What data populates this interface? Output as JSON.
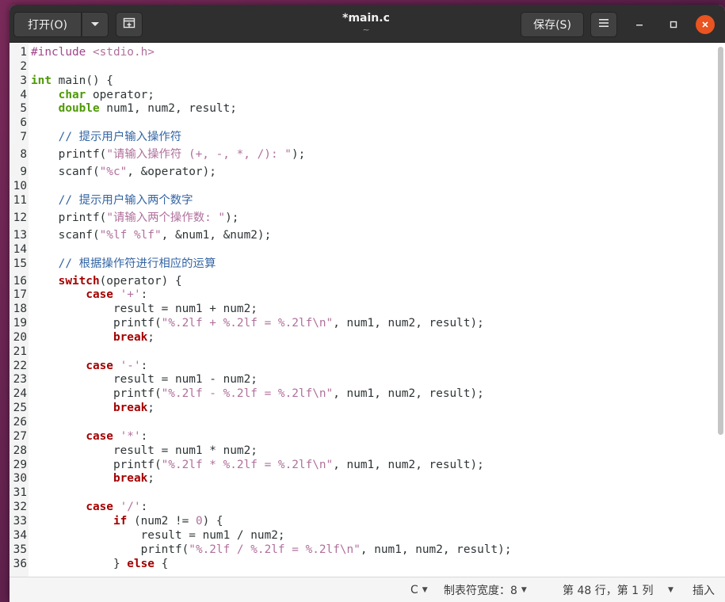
{
  "window": {
    "title": "*main.c",
    "subtitle": "~"
  },
  "toolbar": {
    "open_label": "打开(O)",
    "open_menu_icon": "chevron-down-icon",
    "new_tab_icon": "new-tab-icon",
    "save_label": "保存(S)",
    "menu_icon": "hamburger-icon"
  },
  "window_controls": {
    "minimize_icon": "minimize-icon",
    "maximize_icon": "maximize-icon",
    "close_icon": "close-icon",
    "close_color": "#e95420"
  },
  "editor": {
    "colors": {
      "preprocessor": "#a0468c",
      "keyword": "#a40000",
      "type": "#4e9a06",
      "string": "#b0709c",
      "comment": "#3465a4"
    },
    "lines": [
      {
        "n": "1",
        "tokens": [
          {
            "t": "#include ",
            "c": "pp"
          },
          {
            "t": "<stdio.h>",
            "c": "str"
          }
        ]
      },
      {
        "n": "2",
        "tokens": []
      },
      {
        "n": "3",
        "tokens": [
          {
            "t": "int",
            "c": "ty"
          },
          {
            "t": " main() {",
            "c": ""
          }
        ]
      },
      {
        "n": "4",
        "tokens": [
          {
            "t": "    ",
            "c": ""
          },
          {
            "t": "char",
            "c": "ty"
          },
          {
            "t": " operator;",
            "c": ""
          }
        ]
      },
      {
        "n": "5",
        "tokens": [
          {
            "t": "    ",
            "c": ""
          },
          {
            "t": "double",
            "c": "ty"
          },
          {
            "t": " num1, num2, result;",
            "c": ""
          }
        ]
      },
      {
        "n": "6",
        "tokens": []
      },
      {
        "n": "7",
        "tokens": [
          {
            "t": "    // 提示用户输入操作符",
            "c": "cm"
          }
        ]
      },
      {
        "n": "8",
        "tokens": [
          {
            "t": "    printf(",
            "c": ""
          },
          {
            "t": "\"请输入操作符 (+, -, *, /): \"",
            "c": "str"
          },
          {
            "t": ");",
            "c": ""
          }
        ]
      },
      {
        "n": "9",
        "tokens": [
          {
            "t": "    scanf(",
            "c": ""
          },
          {
            "t": "\"%c\"",
            "c": "str"
          },
          {
            "t": ", &operator);",
            "c": ""
          }
        ]
      },
      {
        "n": "10",
        "tokens": []
      },
      {
        "n": "11",
        "tokens": [
          {
            "t": "    // 提示用户输入两个数字",
            "c": "cm"
          }
        ]
      },
      {
        "n": "12",
        "tokens": [
          {
            "t": "    printf(",
            "c": ""
          },
          {
            "t": "\"请输入两个操作数: \"",
            "c": "str"
          },
          {
            "t": ");",
            "c": ""
          }
        ]
      },
      {
        "n": "13",
        "tokens": [
          {
            "t": "    scanf(",
            "c": ""
          },
          {
            "t": "\"%lf %lf\"",
            "c": "str"
          },
          {
            "t": ", &num1, &num2);",
            "c": ""
          }
        ]
      },
      {
        "n": "14",
        "tokens": []
      },
      {
        "n": "15",
        "tokens": [
          {
            "t": "    // 根据操作符进行相应的运算",
            "c": "cm"
          }
        ]
      },
      {
        "n": "16",
        "tokens": [
          {
            "t": "    ",
            "c": ""
          },
          {
            "t": "switch",
            "c": "kw"
          },
          {
            "t": "(operator) {",
            "c": ""
          }
        ]
      },
      {
        "n": "17",
        "tokens": [
          {
            "t": "        ",
            "c": ""
          },
          {
            "t": "case",
            "c": "kw"
          },
          {
            "t": " ",
            "c": ""
          },
          {
            "t": "'+'",
            "c": "str"
          },
          {
            "t": ":",
            "c": ""
          }
        ]
      },
      {
        "n": "18",
        "tokens": [
          {
            "t": "            result = num1 + num2;",
            "c": ""
          }
        ]
      },
      {
        "n": "19",
        "tokens": [
          {
            "t": "            printf(",
            "c": ""
          },
          {
            "t": "\"%.2lf + %.2lf = %.2lf\\n\"",
            "c": "str"
          },
          {
            "t": ", num1, num2, result);",
            "c": ""
          }
        ]
      },
      {
        "n": "20",
        "tokens": [
          {
            "t": "            ",
            "c": ""
          },
          {
            "t": "break",
            "c": "kw"
          },
          {
            "t": ";",
            "c": ""
          }
        ]
      },
      {
        "n": "21",
        "tokens": []
      },
      {
        "n": "22",
        "tokens": [
          {
            "t": "        ",
            "c": ""
          },
          {
            "t": "case",
            "c": "kw"
          },
          {
            "t": " ",
            "c": ""
          },
          {
            "t": "'-'",
            "c": "str"
          },
          {
            "t": ":",
            "c": ""
          }
        ]
      },
      {
        "n": "23",
        "tokens": [
          {
            "t": "            result = num1 - num2;",
            "c": ""
          }
        ]
      },
      {
        "n": "24",
        "tokens": [
          {
            "t": "            printf(",
            "c": ""
          },
          {
            "t": "\"%.2lf - %.2lf = %.2lf\\n\"",
            "c": "str"
          },
          {
            "t": ", num1, num2, result);",
            "c": ""
          }
        ]
      },
      {
        "n": "25",
        "tokens": [
          {
            "t": "            ",
            "c": ""
          },
          {
            "t": "break",
            "c": "kw"
          },
          {
            "t": ";",
            "c": ""
          }
        ]
      },
      {
        "n": "26",
        "tokens": []
      },
      {
        "n": "27",
        "tokens": [
          {
            "t": "        ",
            "c": ""
          },
          {
            "t": "case",
            "c": "kw"
          },
          {
            "t": " ",
            "c": ""
          },
          {
            "t": "'*'",
            "c": "str"
          },
          {
            "t": ":",
            "c": ""
          }
        ]
      },
      {
        "n": "28",
        "tokens": [
          {
            "t": "            result = num1 * num2;",
            "c": ""
          }
        ]
      },
      {
        "n": "29",
        "tokens": [
          {
            "t": "            printf(",
            "c": ""
          },
          {
            "t": "\"%.2lf * %.2lf = %.2lf\\n\"",
            "c": "str"
          },
          {
            "t": ", num1, num2, result);",
            "c": ""
          }
        ]
      },
      {
        "n": "30",
        "tokens": [
          {
            "t": "            ",
            "c": ""
          },
          {
            "t": "break",
            "c": "kw"
          },
          {
            "t": ";",
            "c": ""
          }
        ]
      },
      {
        "n": "31",
        "tokens": []
      },
      {
        "n": "32",
        "tokens": [
          {
            "t": "        ",
            "c": ""
          },
          {
            "t": "case",
            "c": "kw"
          },
          {
            "t": " ",
            "c": ""
          },
          {
            "t": "'/'",
            "c": "str"
          },
          {
            "t": ":",
            "c": ""
          }
        ]
      },
      {
        "n": "33",
        "tokens": [
          {
            "t": "            ",
            "c": ""
          },
          {
            "t": "if",
            "c": "kw"
          },
          {
            "t": " (num2 != ",
            "c": ""
          },
          {
            "t": "0",
            "c": "str"
          },
          {
            "t": ") {",
            "c": ""
          }
        ]
      },
      {
        "n": "34",
        "tokens": [
          {
            "t": "                result = num1 / num2;",
            "c": ""
          }
        ]
      },
      {
        "n": "35",
        "tokens": [
          {
            "t": "                printf(",
            "c": ""
          },
          {
            "t": "\"%.2lf / %.2lf = %.2lf\\n\"",
            "c": "str"
          },
          {
            "t": ", num1, num2, result);",
            "c": ""
          }
        ]
      },
      {
        "n": "36",
        "tokens": [
          {
            "t": "            } ",
            "c": ""
          },
          {
            "t": "else",
            "c": "kw"
          },
          {
            "t": " {",
            "c": ""
          }
        ]
      }
    ]
  },
  "statusbar": {
    "language": "C",
    "tab_width": "制表符宽度：8",
    "position": "第 48 行，第 1 列",
    "mode": "插入"
  }
}
